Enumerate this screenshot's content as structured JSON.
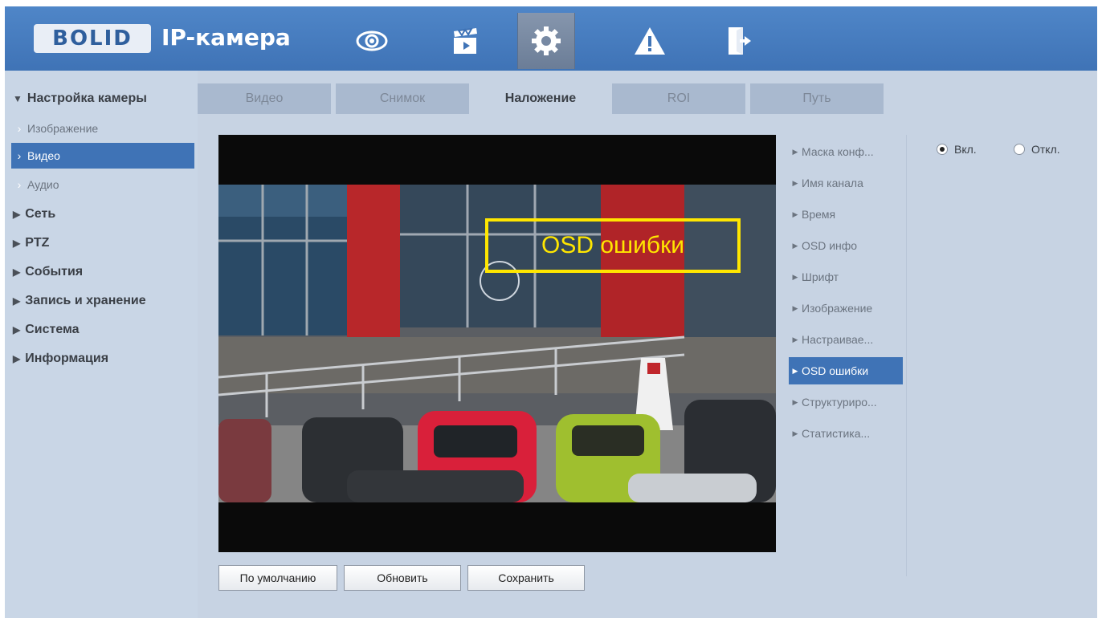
{
  "header": {
    "logo_text": "BOLID",
    "product_title": "IP-камера",
    "nav_icons": [
      "eye-icon",
      "clapperboard-icon",
      "gear-icon",
      "warning-icon",
      "logout-icon"
    ],
    "active_nav": "gear-icon"
  },
  "sidebar": {
    "camera_settings": "Настройка камеры",
    "sub_items": [
      "Изображение",
      "Видео",
      "Аудио"
    ],
    "active_sub": "Видео",
    "sections": [
      "Сеть",
      "PTZ",
      "События",
      "Запись и хранение",
      "Система",
      "Информация"
    ]
  },
  "tabs": [
    "Видео",
    "Снимок",
    "Наложение",
    "ROI",
    "Путь"
  ],
  "active_tab": "Наложение",
  "preview": {
    "osd_text": "OSD ошибки"
  },
  "overlay_menu": {
    "items": [
      "Маска конф...",
      "Имя канала",
      "Время",
      "OSD инфо",
      "Шрифт",
      "Изображение",
      "Настраивае...",
      "OSD ошибки",
      "Структуриро...",
      "Статистика..."
    ],
    "active": "OSD ошибки"
  },
  "radio": {
    "on_label": "Вкл.",
    "off_label": "Откл.",
    "selected": "on"
  },
  "buttons": {
    "default": "По умолчанию",
    "refresh": "Обновить",
    "save": "Сохранить"
  },
  "colors": {
    "header_blue": "#3f73b6",
    "active_highlight": "#3f73b6",
    "osd_yellow": "#ffe600",
    "panel_bg": "#c7d3e3"
  }
}
